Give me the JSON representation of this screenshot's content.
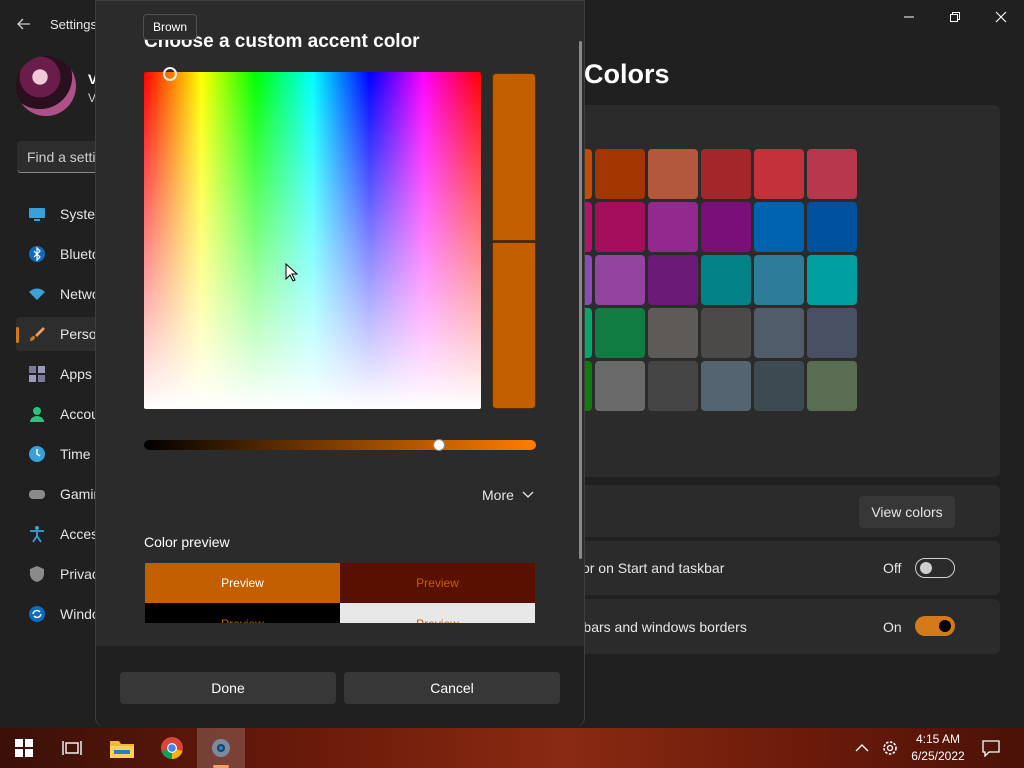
{
  "settings": {
    "title": "Settings",
    "user": {
      "name": "V",
      "sub": "V"
    },
    "search_placeholder": "Find a setting",
    "nav": [
      {
        "label": "System",
        "icon": "system-icon"
      },
      {
        "label": "Bluetooth & devices",
        "icon": "bluetooth-icon"
      },
      {
        "label": "Network & internet",
        "icon": "network-icon"
      },
      {
        "label": "Personalization",
        "icon": "brush-icon",
        "active": true
      },
      {
        "label": "Apps",
        "icon": "apps-icon"
      },
      {
        "label": "Accounts",
        "icon": "accounts-icon"
      },
      {
        "label": "Time & language",
        "icon": "time-icon"
      },
      {
        "label": "Gaming",
        "icon": "gaming-icon"
      },
      {
        "label": "Accessibility",
        "icon": "accessibility-icon"
      },
      {
        "label": "Privacy & security",
        "icon": "shield-icon"
      },
      {
        "label": "Windows Update",
        "icon": "update-icon"
      }
    ],
    "page_title": "Colors",
    "swatch_colors": [
      [
        "#c44b00",
        "#a33500",
        "#b3573d",
        "#a3262a",
        "#c4313a",
        "#b8374c"
      ],
      [
        "#b5126b",
        "#a50e5c",
        "#93288e",
        "#7a0f7a",
        "#0063b1",
        "#0052a0"
      ],
      [
        "#8b4ab8",
        "#93449e",
        "#6b1a78",
        "#038387",
        "#2d7d9a",
        "#00a0a0"
      ],
      [
        "#00a86b",
        "#107c41",
        "#5d5a58",
        "#4c4a48",
        "#515c6b",
        "#4a5063"
      ],
      [
        "#107c10",
        "#696969",
        "#454545",
        "#546470",
        "#3e4a52",
        "#586d52"
      ]
    ],
    "view_colors_label": "View colors",
    "row_taskbar": "Show accent color on Start and taskbar",
    "row_taskbar_state": "Off",
    "row_borders": "Show accent color on title bars and windows borders",
    "row_borders_state": "On",
    "accent": "#d47a1a"
  },
  "dialog": {
    "tooltip": "Brown",
    "title": "Choose a custom accent color",
    "selected_color": "#c45f00",
    "more_label": "More",
    "preview_section": "Color preview",
    "preview_cells": [
      {
        "label": "Preview",
        "bg": "#c45f00",
        "fg": "#ffffff"
      },
      {
        "label": "Preview",
        "bg": "#5a1000",
        "fg": "#c45f00"
      },
      {
        "label": "Preview",
        "bg": "#000000",
        "fg": "#c45f00"
      },
      {
        "label": "Preview",
        "bg": "#e8e8e8",
        "fg": "#c45f00"
      }
    ],
    "done_label": "Done",
    "cancel_label": "Cancel"
  },
  "taskbar": {
    "time": "4:15 AM",
    "date": "6/25/2022"
  }
}
